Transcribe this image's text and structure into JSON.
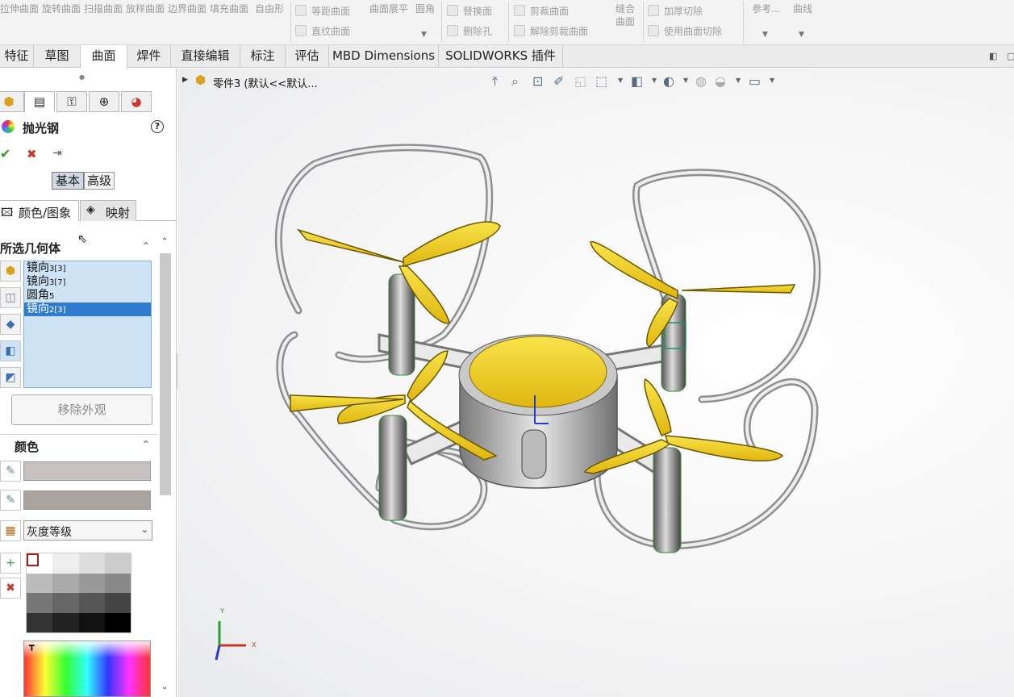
{
  "ribbon": {
    "tools": [
      "拉伸曲面",
      "旋转曲面",
      "扫描曲面",
      "放样曲面",
      "边界曲面",
      "填充曲面"
    ],
    "freeform": "自由形",
    "offset": "等距曲面",
    "ruled": "直纹曲面",
    "flatten": "曲面展平",
    "fillet": "圆角",
    "replace": "替换面",
    "delete_hole": "删除孔",
    "trim": "剪裁曲面",
    "untrim": "解除剪裁曲面",
    "knit": "缝合曲面",
    "thicken_cut": "加厚切除",
    "surface_cut": "使用曲面切除",
    "reference": "参考...",
    "curves": "曲线"
  },
  "tabs": [
    "特征",
    "草图",
    "曲面",
    "焊件",
    "直接编辑",
    "标注",
    "评估",
    "MBD Dimensions",
    "SOLIDWORKS 插件"
  ],
  "active_tab": "曲面",
  "panel": {
    "title": "抛光钢",
    "help": "?",
    "ok": "✔",
    "cancel": "✖",
    "pin": "⇥",
    "mode_basic": "基本",
    "mode_advanced": "高级",
    "tab_color": "颜色/图象",
    "tab_mapping": "映射",
    "geometry_header": "所选几何体",
    "geometry_items": [
      {
        "name": "镜向",
        "sub": "3[3]"
      },
      {
        "name": "镜向",
        "sub": "3[7]"
      },
      {
        "name": "圆角",
        "sub": "5"
      },
      {
        "name": "镜向",
        "sub": "2[3]",
        "selected": true
      }
    ],
    "remove_button": "移除外观",
    "color_header": "颜色",
    "color1": "#c8c0c0",
    "color2": "#aaa3a0",
    "swatch_type": "灰度等级",
    "grays": [
      "#ffffff",
      "#eeeeee",
      "#dddddd",
      "#cccccc",
      "#bbbbbb",
      "#aaaaaa",
      "#999999",
      "#888888",
      "#777777",
      "#666666",
      "#555555",
      "#444444",
      "#333333",
      "#222222",
      "#111111",
      "#000000"
    ]
  },
  "viewport": {
    "tree_label": "零件3 (默认<<默认...",
    "axes": {
      "x": "X",
      "y": "Y"
    },
    "accent_yellow": "#f3d21c"
  }
}
